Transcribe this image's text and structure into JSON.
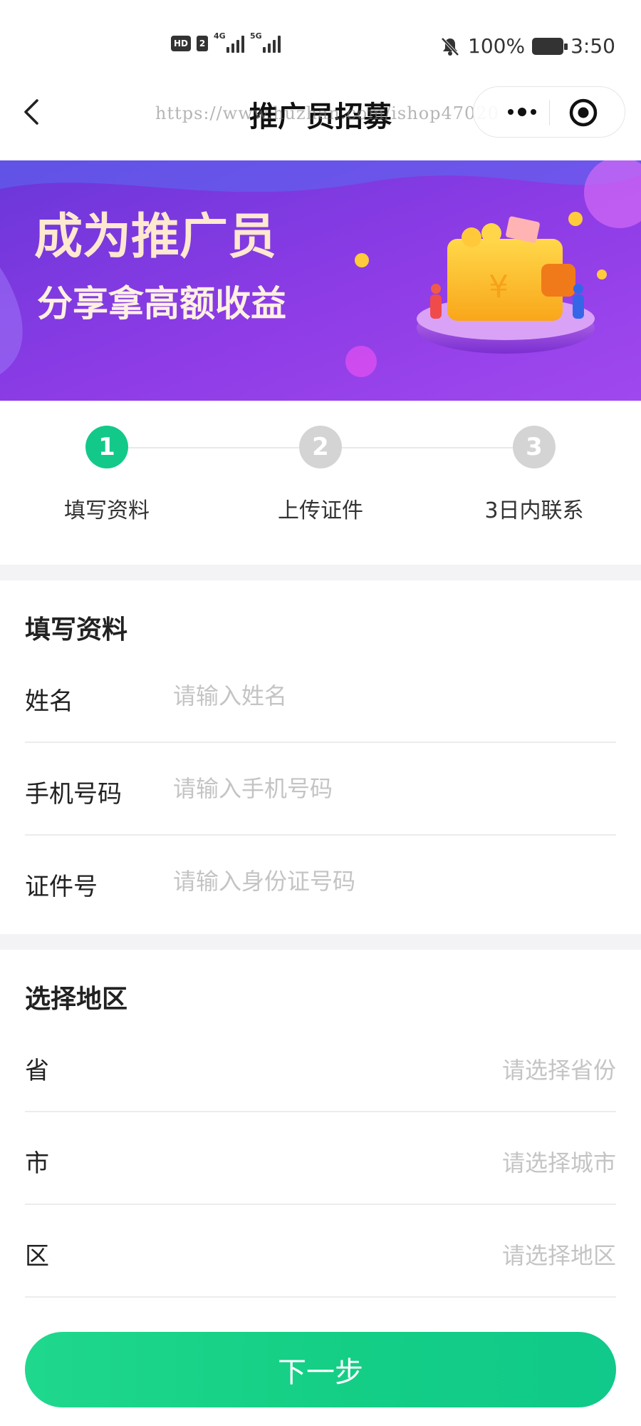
{
  "status_bar": {
    "hd": "HD",
    "sim": "2",
    "net1": "4G",
    "net2": "5G",
    "battery": "100%",
    "time": "3:50"
  },
  "nav": {
    "title": "推广员招募",
    "watermark": "https://www.huzhan.com/ishop47020"
  },
  "banner": {
    "headline": "成为推广员",
    "subline": "分享拿高额收益",
    "currency": "¥"
  },
  "steps": [
    {
      "number": "1",
      "label": "填写资料",
      "active": true
    },
    {
      "number": "2",
      "label": "上传证件",
      "active": false
    },
    {
      "number": "3",
      "label": "3日内联系",
      "active": false
    }
  ],
  "info_section": {
    "title": "填写资料",
    "fields": [
      {
        "label": "姓名",
        "placeholder": "请输入姓名",
        "value": ""
      },
      {
        "label": "手机号码",
        "placeholder": "请输入手机号码",
        "value": ""
      },
      {
        "label": "证件号",
        "placeholder": "请输入身份证号码",
        "value": ""
      }
    ]
  },
  "region_section": {
    "title": "选择地区",
    "fields": [
      {
        "label": "省",
        "placeholder": "请选择省份"
      },
      {
        "label": "市",
        "placeholder": "请选择城市"
      },
      {
        "label": "区",
        "placeholder": "请选择地区"
      }
    ]
  },
  "next_button": {
    "label": "下一步"
  },
  "colors": {
    "accent": "#12c98a",
    "inactive_step": "#d4d4d4",
    "placeholder": "#c4c4c4",
    "banner_purple": "#7a3be0"
  },
  "icons": {
    "back": "chevron-left-icon",
    "more": "more-dots-icon",
    "close": "mini-program-close-icon",
    "mute": "bell-off-icon",
    "battery": "battery-icon",
    "signal": "signal-bars-icon"
  }
}
